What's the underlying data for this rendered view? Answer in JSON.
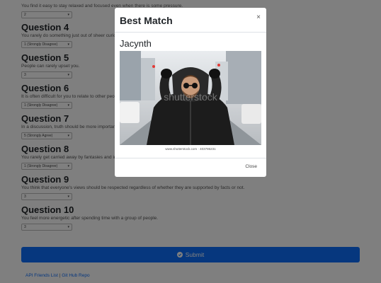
{
  "survey": {
    "top_text": "You find it easy to stay relaxed and focused even when there is some pressure.",
    "top_select": "2",
    "questions": [
      {
        "title": "Question 4",
        "text": "You rarely do something just out of sheer curiosity.",
        "selected": "1 (Strongly Disagree)"
      },
      {
        "title": "Question 5",
        "text": "People can rarely upset you.",
        "selected": "3"
      },
      {
        "title": "Question 6",
        "text": "It is often difficult for you to relate to other people's feelings.",
        "selected": "1 (Strongly Disagree)"
      },
      {
        "title": "Question 7",
        "text": "In a discussion, truth should be more important than people's sensitivities.",
        "selected": "5 (Strongly Agree)"
      },
      {
        "title": "Question 8",
        "text": "You rarely get carried away by fantasies and ideas.",
        "selected": "1 (Strongly Disagree)"
      },
      {
        "title": "Question 9",
        "text": "You think that everyone's views should be respected regardless of whether they are supported by facts or not.",
        "selected": "3"
      },
      {
        "title": "Question 10",
        "text": "You feel more energetic after spending time with a group of people.",
        "selected": "3"
      }
    ],
    "submit_label": "Submit",
    "footer": {
      "link1": "API Friends List",
      "separator": "|",
      "link2": "Git Hub Repo"
    }
  },
  "modal": {
    "title": "Best Match",
    "close_symbol": "×",
    "match_name": "Jacynth",
    "photo_watermark": "shutterstock",
    "photo_caption": "www.shutterstock.com · 403786231",
    "close_label": "Close"
  },
  "icons": {
    "close": "close-icon",
    "check": "check-circle-icon",
    "caret": "caret-down-icon"
  },
  "colors": {
    "primary": "#0d6efd",
    "backdrop": "rgba(0,0,0,0.5)"
  }
}
